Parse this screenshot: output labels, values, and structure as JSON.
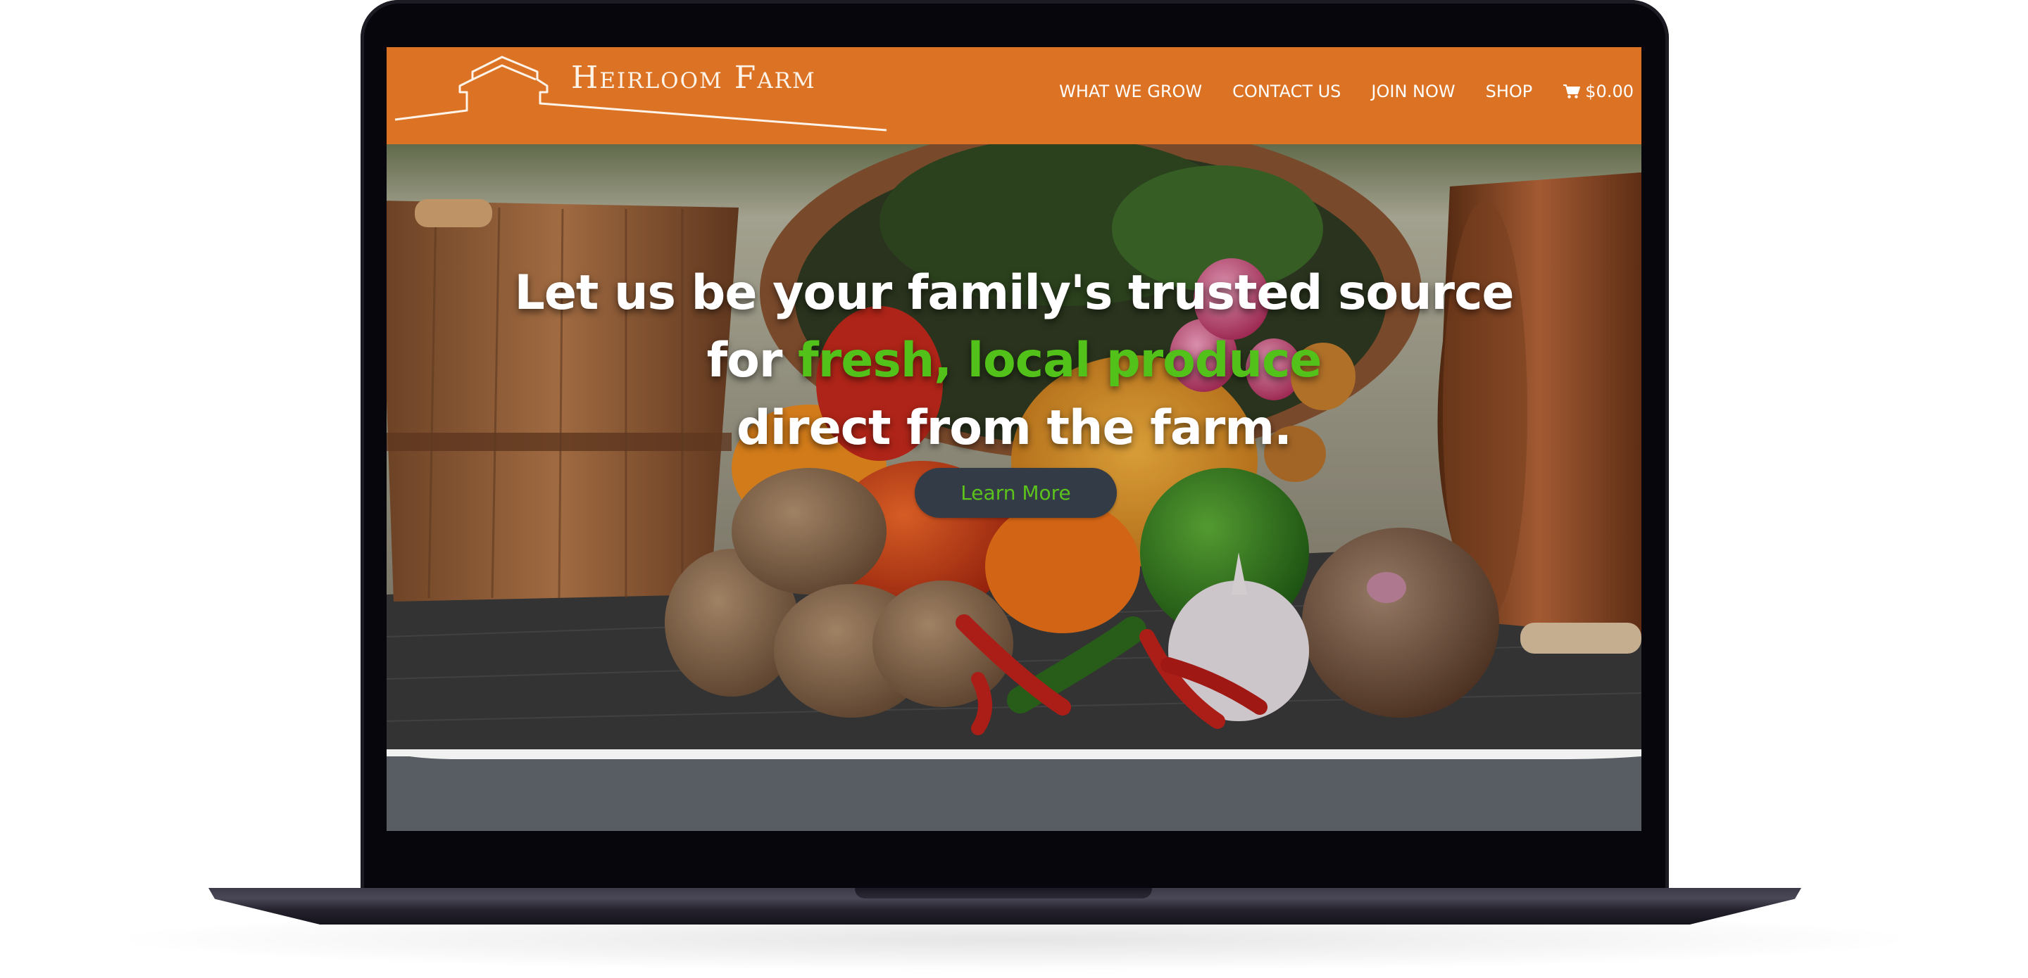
{
  "site": {
    "logo_text": "Heirloom Farm",
    "colors": {
      "header_bg": "#dc7223",
      "highlight_green": "#52c21a",
      "button_bg": "#333b46",
      "lower_section_bg": "#575d63"
    }
  },
  "nav": {
    "items": [
      {
        "label": "WHAT WE GROW"
      },
      {
        "label": "CONTACT US"
      },
      {
        "label": "JOIN NOW"
      },
      {
        "label": "SHOP"
      }
    ],
    "cart": {
      "icon": "cart-icon",
      "total": "$0.00"
    }
  },
  "hero": {
    "line1": "Let us be your family's trusted source",
    "line2_prefix": "for ",
    "line2_highlight": "fresh, local produce",
    "line3": "direct from the farm.",
    "button_label": "Learn More"
  }
}
